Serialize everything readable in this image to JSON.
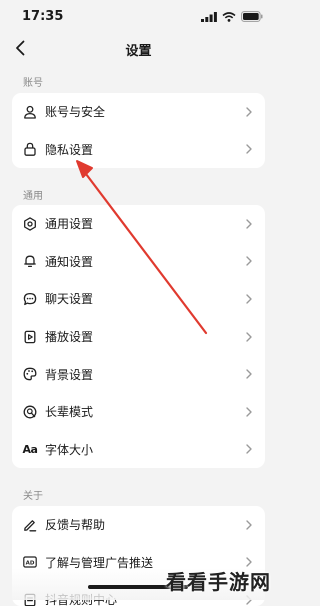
{
  "status_bar": {
    "time": "17:35"
  },
  "nav": {
    "title": "设置"
  },
  "sections": {
    "account": {
      "label": "账号",
      "items": [
        {
          "label": "账号与安全",
          "icon": "user-icon"
        },
        {
          "label": "隐私设置",
          "icon": "lock-icon"
        }
      ]
    },
    "general": {
      "label": "通用",
      "items": [
        {
          "label": "通用设置",
          "icon": "gear-icon"
        },
        {
          "label": "通知设置",
          "icon": "bell-icon"
        },
        {
          "label": "聊天设置",
          "icon": "chat-icon"
        },
        {
          "label": "播放设置",
          "icon": "play-icon"
        },
        {
          "label": "背景设置",
          "icon": "palette-icon"
        },
        {
          "label": "长辈模式",
          "icon": "elder-mode-icon"
        },
        {
          "label": "字体大小",
          "icon": "font-size-icon",
          "glyph": "Aa"
        }
      ]
    },
    "about": {
      "label": "关于",
      "items": [
        {
          "label": "反馈与帮助",
          "icon": "edit-icon"
        },
        {
          "label": "了解与管理广告推送",
          "icon": "ad-icon",
          "glyph": "AD"
        },
        {
          "label": "抖音规则中心",
          "icon": "rules-icon"
        }
      ]
    }
  },
  "watermark": {
    "text": "看看手游网"
  },
  "colors": {
    "arrow": "#e03a2f",
    "background": "#f3f3f3",
    "card": "#ffffff"
  }
}
